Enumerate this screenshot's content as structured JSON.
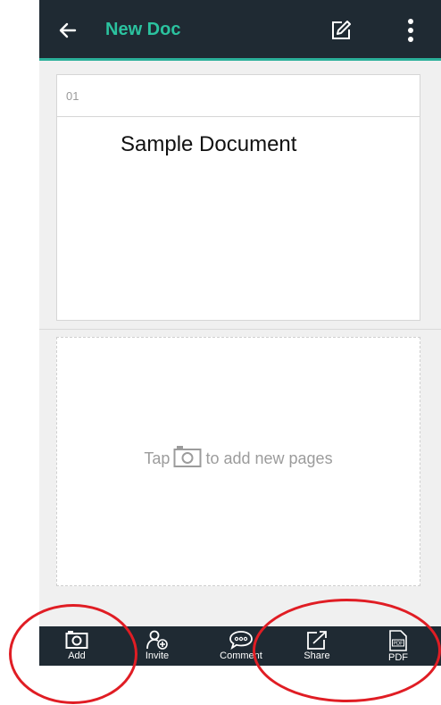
{
  "appbar": {
    "title": "New Doc",
    "back_icon": "arrow-left-icon",
    "edit_icon": "edit-icon",
    "menu_icon": "more-vertical-icon"
  },
  "page": {
    "number": "01",
    "title": "Sample Document"
  },
  "add_zone": {
    "hint_before": "Tap",
    "hint_after": "to add new pages",
    "icon": "camera-icon"
  },
  "toolbar": {
    "items": [
      {
        "label": "Add",
        "icon": "camera-icon"
      },
      {
        "label": "Invite",
        "icon": "invite-user-icon"
      },
      {
        "label": "Comment",
        "icon": "comment-icon"
      },
      {
        "label": "Share",
        "icon": "share-icon"
      },
      {
        "label": "PDF",
        "icon": "pdf-icon",
        "badge": "PDF"
      }
    ]
  },
  "colors": {
    "bar_bg": "#1f2a33",
    "accent": "#2bc29f",
    "annotation": "#e01d24"
  }
}
